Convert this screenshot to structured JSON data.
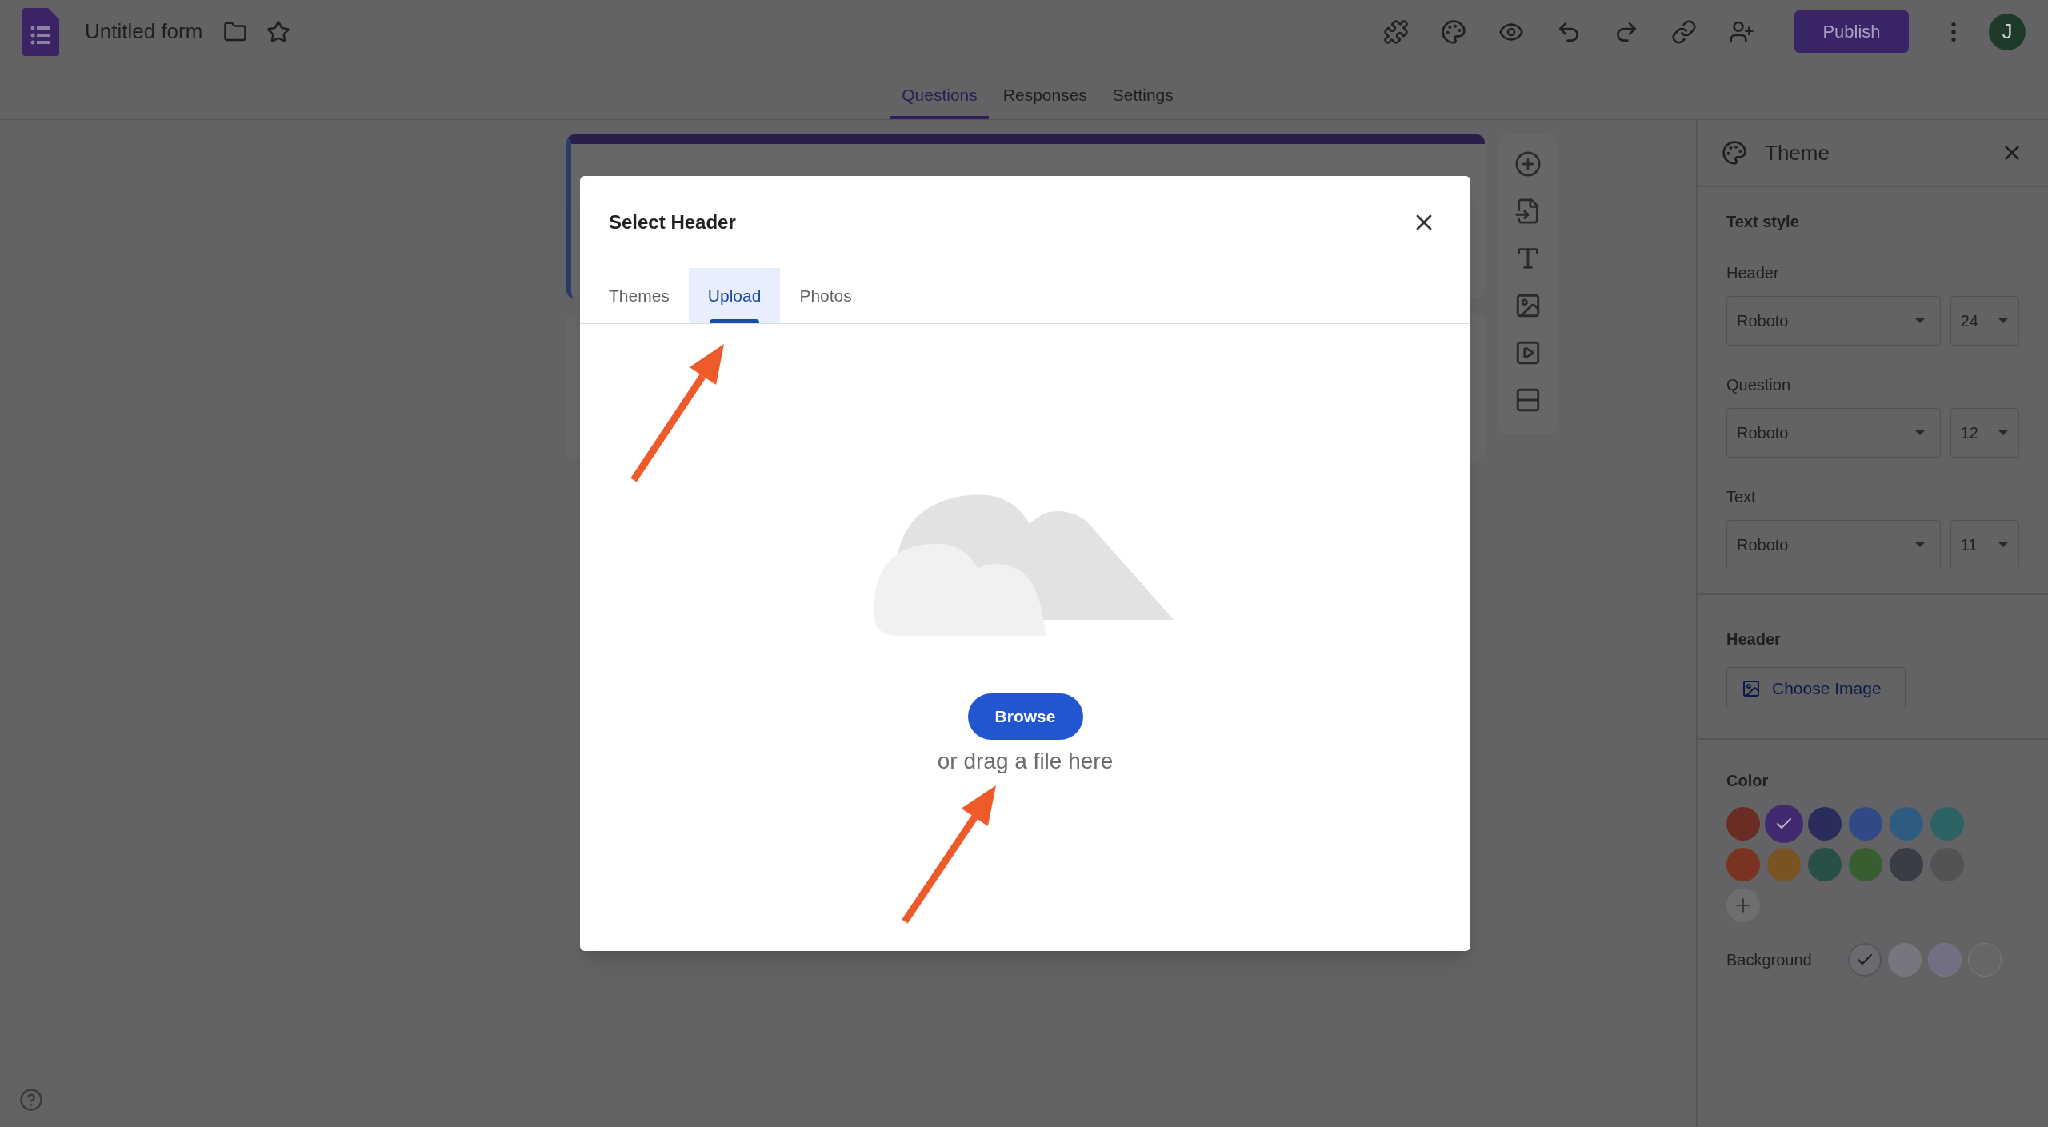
{
  "app": {
    "title": "Untitled form",
    "publish": "Publish",
    "avatar": "J"
  },
  "tabs": [
    {
      "label": "Questions",
      "selected": true
    },
    {
      "label": "Responses",
      "selected": false
    },
    {
      "label": "Settings",
      "selected": false
    }
  ],
  "theme_panel": {
    "title": "Theme",
    "text_style": {
      "heading": "Text style",
      "rows": [
        {
          "label": "Header",
          "font": "Roboto",
          "size": "24"
        },
        {
          "label": "Question",
          "font": "Roboto",
          "size": "12"
        },
        {
          "label": "Text",
          "font": "Roboto",
          "size": "11"
        }
      ]
    },
    "header": {
      "heading": "Header",
      "button": "Choose Image"
    },
    "color": {
      "heading": "Color",
      "swatches": [
        {
          "color": "#6b2c24",
          "selected": false
        },
        {
          "color": "#43296f",
          "selected": true
        },
        {
          "color": "#2a2d5c",
          "selected": false
        },
        {
          "color": "#2f4a86",
          "selected": false
        },
        {
          "color": "#2d5c80",
          "selected": false
        },
        {
          "color": "#2d6365",
          "selected": false
        },
        {
          "color": "#7a3320",
          "selected": false
        },
        {
          "color": "#7a5322",
          "selected": false
        },
        {
          "color": "#285046",
          "selected": false
        },
        {
          "color": "#375d31",
          "selected": false
        },
        {
          "color": "#3a3e44",
          "selected": false
        },
        {
          "color": "#525453",
          "selected": false
        }
      ]
    },
    "background": {
      "label": "Background",
      "swatches": [
        {
          "color": "#6b6a70",
          "selected": true
        },
        {
          "color": "#78757f",
          "selected": false
        },
        {
          "color": "#736f83",
          "selected": false
        },
        {
          "color": "#666666",
          "selected": false
        }
      ]
    }
  },
  "dialog": {
    "title": "Select Header",
    "tabs": [
      {
        "label": "Themes",
        "selected": false
      },
      {
        "label": "Upload",
        "selected": true
      },
      {
        "label": "Photos",
        "selected": false
      }
    ],
    "browse": "Browse",
    "hint": "or drag a file here"
  }
}
